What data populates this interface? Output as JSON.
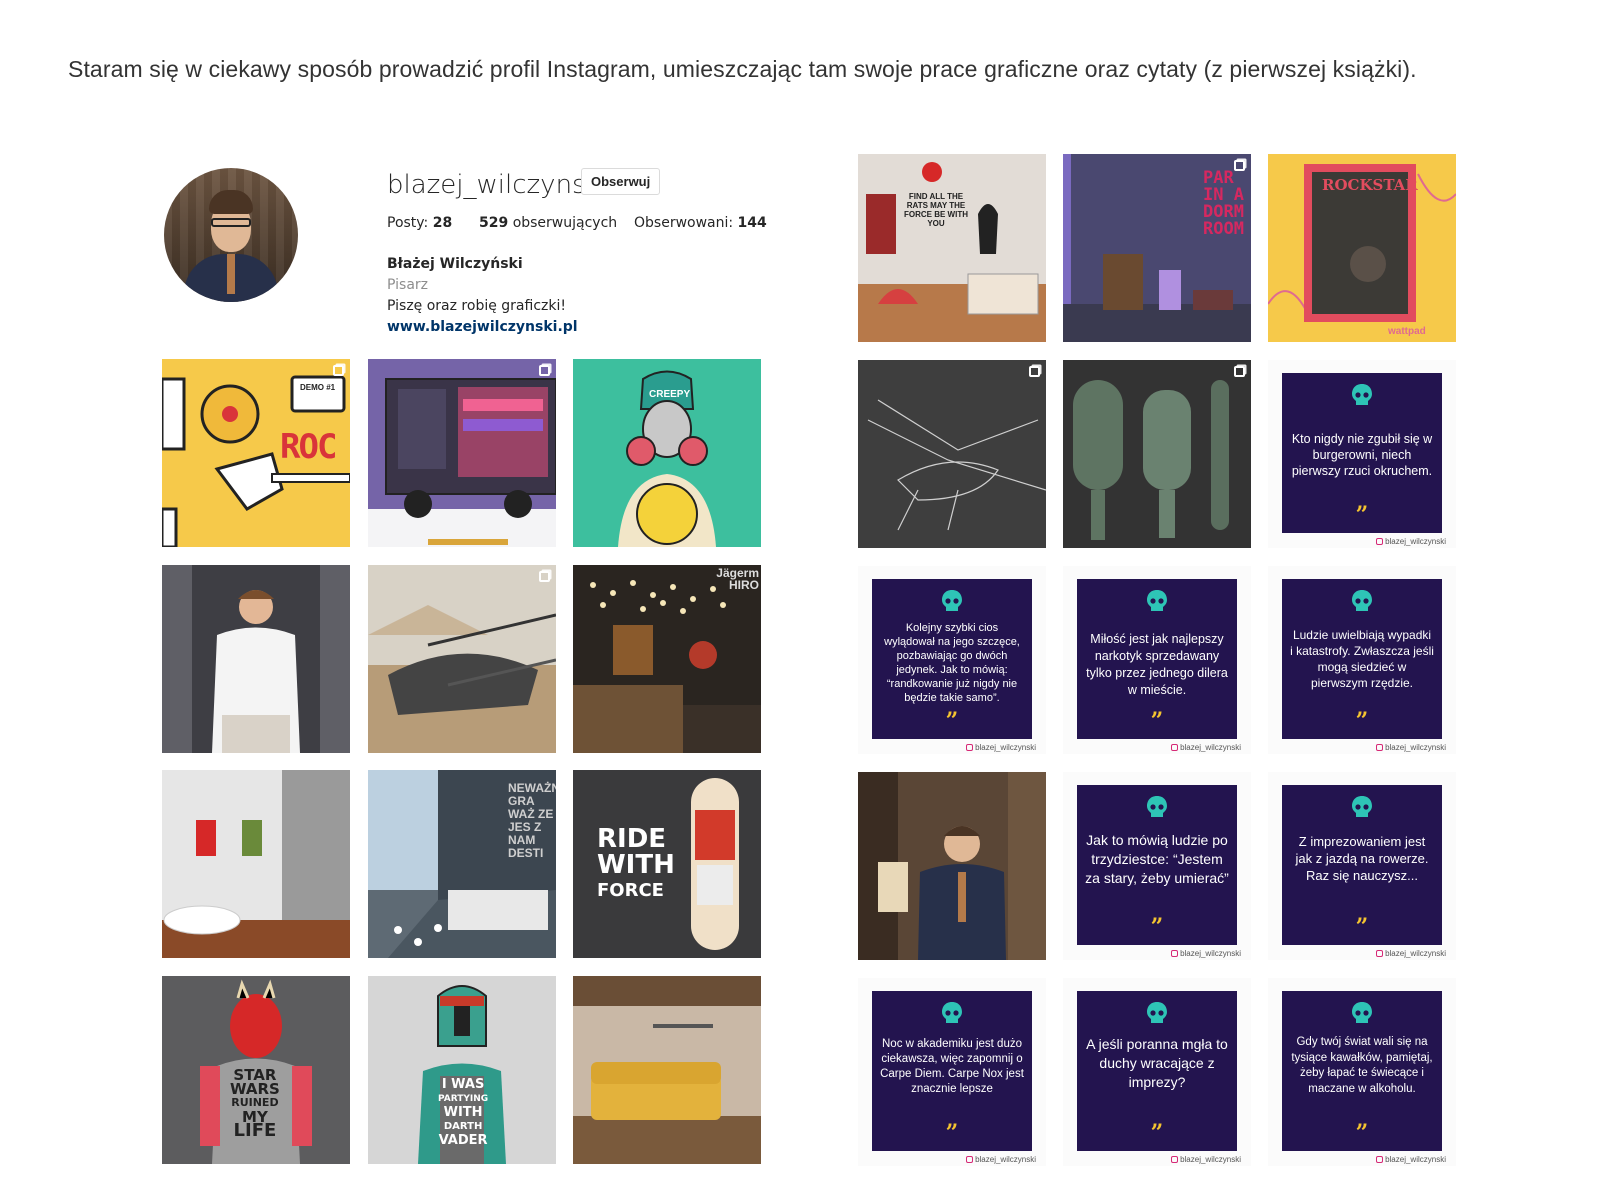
{
  "intro": "Staram się w ciekawy sposób prowadzić profil Instagram, umieszczając tam swoje prace graficzne oraz cytaty (z pierwszej książki).",
  "profile": {
    "username": "blazej_wilczynski",
    "follow_label": "Obserwuj",
    "posts_label": "Posty:",
    "posts_count": "28",
    "followers_count": "529",
    "followers_label": "obserwujących",
    "following_label": "Obserwowani:",
    "following_count": "144",
    "full_name": "Błażej Wilczyński",
    "category": "Pisarz",
    "bio": "Piszę oraz robię graficzki!",
    "website": "www.blazejwilczynski.pl"
  },
  "left_posts": {
    "rock_text": "ROC",
    "demo_text": "DEMO #1",
    "creepy_text": "CREEPY",
    "ride_text_1": "RIDE",
    "ride_text_2": "WITH",
    "ride_text_3": "FORCE",
    "starwars_text_1": "STAR",
    "starwars_text_2": "WARS",
    "starwars_text_3": "RUINED",
    "starwars_text_4": "MY",
    "starwars_text_5": "LIFE",
    "vader_text_1": "I WAS",
    "vader_text_2": "PARTYING",
    "vader_text_3": "WITH",
    "vader_text_4": "DARTH",
    "vader_text_5": "VADER",
    "jager_text_1": "Jägerm",
    "jager_text_2": "HIRO",
    "bedroom_text": "NEWAŻNE GRA WAŻ ZE JES Z NAM DESTI"
  },
  "right_posts": {
    "rats_text": "FIND ALL THE RATS MAY THE FORCE BE WITH YOU",
    "party_text": "PAR IN A DORM ROOM",
    "rockstar_text": "ROCKSTAR",
    "wattpad_text": "wattpad",
    "handle": "blazej_wilczynski",
    "quotes": [
      "Kto nigdy nie zgubił się w burgerowni, niech pierwszy rzuci okruchem.",
      "Kolejny szybki cios wylądował na jego szczęce, pozbawiając go dwóch jedynek. Jak to mówią: “randkowanie już nigdy nie będzie takie samo”.",
      "Miłość jest jak najlepszy narkotyk sprzedawany tylko przez jednego dilera w mieście.",
      "Ludzie uwielbiają wypadki i katastrofy. Zwłaszcza jeśli mogą siedzieć w pierwszym rzędzie.",
      "Jak to mówią ludzie po trzydziestce: “Jestem za stary, żeby umierać”",
      "Z imprezowaniem jest jak z jazdą na rowerze. Raz się nauczysz...",
      "Noc w akademiku jest dużo ciekawsza, więc zapomnij o Carpe Diem. Carpe Nox jest znacznie lepsze",
      "A jeśli poranna mgła to duchy wracające z imprezy?",
      "Gdy twój świat wali się na tysiące kawałków, pamiętaj, żeby łapać te świecące i maczane w alkoholu."
    ],
    "quote_mark": "”"
  },
  "colors": {
    "quote_bg": "#23144f",
    "skull": "#2ec4b6",
    "quote_mark": "#f4c430",
    "link": "#003569"
  }
}
